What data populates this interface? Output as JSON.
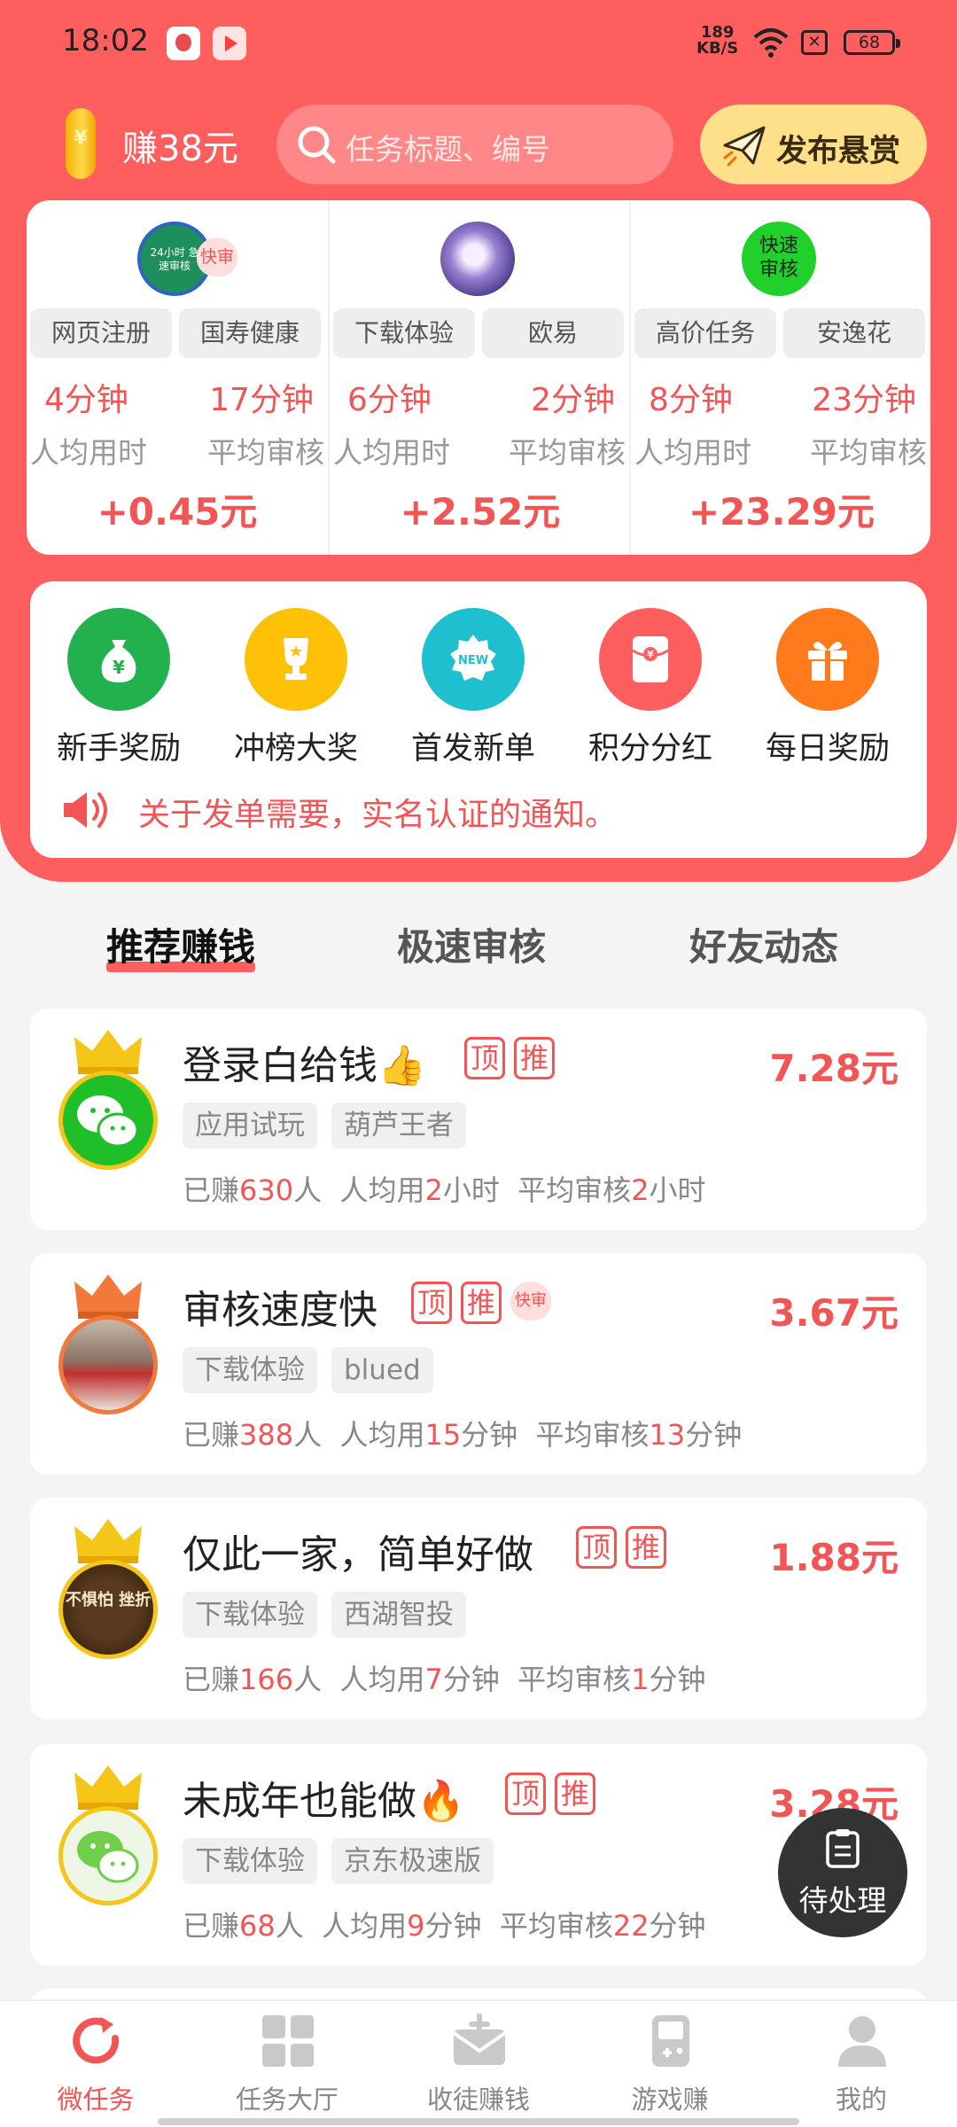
{
  "status_bar": {
    "time": "18:02",
    "net_speed_value": "189",
    "net_speed_unit": "KB/S",
    "battery": "68"
  },
  "header": {
    "balance": "赚38元",
    "search_placeholder": "任务标题、编号",
    "publish_label": "发布悬赏"
  },
  "featured": [
    {
      "badge": "快审",
      "avatar_text": "24小时 急速审核",
      "tags": [
        "网页注册",
        "国寿健康"
      ],
      "user_time": "4分钟",
      "review_time": "17分钟",
      "user_time_label": "人均用时",
      "review_time_label": "平均审核",
      "reward": "+0.45元"
    },
    {
      "badge": "",
      "avatar_text": "",
      "tags": [
        "下载体验",
        "欧易"
      ],
      "user_time": "6分钟",
      "review_time": "2分钟",
      "user_time_label": "人均用时",
      "review_time_label": "平均审核",
      "reward": "+2.52元"
    },
    {
      "badge": "",
      "avatar_text": "快速 审核",
      "tags": [
        "高价任务",
        "安逸花"
      ],
      "user_time": "8分钟",
      "review_time": "23分钟",
      "user_time_label": "人均用时",
      "review_time_label": "平均审核",
      "reward": "+23.29元"
    }
  ],
  "quick_menu": [
    {
      "label": "新手奖励",
      "icon": "money-bag-icon",
      "color": "#22b14c"
    },
    {
      "label": "冲榜大奖",
      "icon": "trophy-icon",
      "color": "#ffc107"
    },
    {
      "label": "首发新单",
      "icon": "new-badge-icon",
      "color": "#1ec0cf"
    },
    {
      "label": "积分分红",
      "icon": "red-envelope-icon",
      "color": "#ff5e5e"
    },
    {
      "label": "每日奖励",
      "icon": "gift-icon",
      "color": "#ff7a1a"
    }
  ],
  "notice": "关于发单需要，实名认证的通知。",
  "tabs": [
    "推荐赚钱",
    "极速审核",
    "好友动态"
  ],
  "tasks": [
    {
      "title": "登录白给钱👍",
      "top": "顶",
      "rec": "推",
      "fast": "",
      "price": "7.28元",
      "tags": [
        "应用试玩",
        "葫芦王者"
      ],
      "s_pre": "已赚",
      "earned": "630",
      "s_mid1": "人  人均用",
      "avg_num": "2",
      "avg_unit": "小时",
      "s_mid2": "  平均审核",
      "rev_num": "2",
      "rev_unit": "小时"
    },
    {
      "title": "审核速度快",
      "top": "顶",
      "rec": "推",
      "fast": "快审",
      "price": "3.67元",
      "tags": [
        "下载体验",
        "blued"
      ],
      "s_pre": "已赚",
      "earned": "388",
      "s_mid1": "人  人均用",
      "avg_num": "15",
      "avg_unit": "分钟",
      "s_mid2": "  平均审核",
      "rev_num": "13",
      "rev_unit": "分钟"
    },
    {
      "title": "仅此一家，简单好做",
      "top": "顶",
      "rec": "推",
      "fast": "",
      "price": "1.88元",
      "tags": [
        "下载体验",
        "西湖智投"
      ],
      "avatar_text": "不惧怕 挫折",
      "s_pre": "已赚",
      "earned": "166",
      "s_mid1": "人  人均用",
      "avg_num": "7",
      "avg_unit": "分钟",
      "s_mid2": "  平均审核",
      "rev_num": "1",
      "rev_unit": "分钟"
    },
    {
      "title": "未成年也能做🔥",
      "top": "顶",
      "rec": "推",
      "fast": "",
      "price": "3.28元",
      "tags": [
        "下载体验",
        "京东极速版"
      ],
      "s_pre": "已赚",
      "earned": "68",
      "s_mid1": "人  人均用",
      "avg_num": "9",
      "avg_unit": "分钟",
      "s_mid2": "  平均审核",
      "rev_num": "22",
      "rev_unit": "分钟"
    }
  ],
  "pending_label": "待处理",
  "bottom_nav": [
    {
      "label": "微任务",
      "icon": "refresh-icon"
    },
    {
      "label": "任务大厅",
      "icon": "grid-icon"
    },
    {
      "label": "收徒赚钱",
      "icon": "envelope-icon"
    },
    {
      "label": "游戏赚",
      "icon": "gamepad-icon"
    },
    {
      "label": "我的",
      "icon": "user-icon"
    }
  ],
  "colors": {
    "brand": "#ff5e5e",
    "accent_text": "#f25555",
    "publish_bg": "#ffe08a"
  }
}
